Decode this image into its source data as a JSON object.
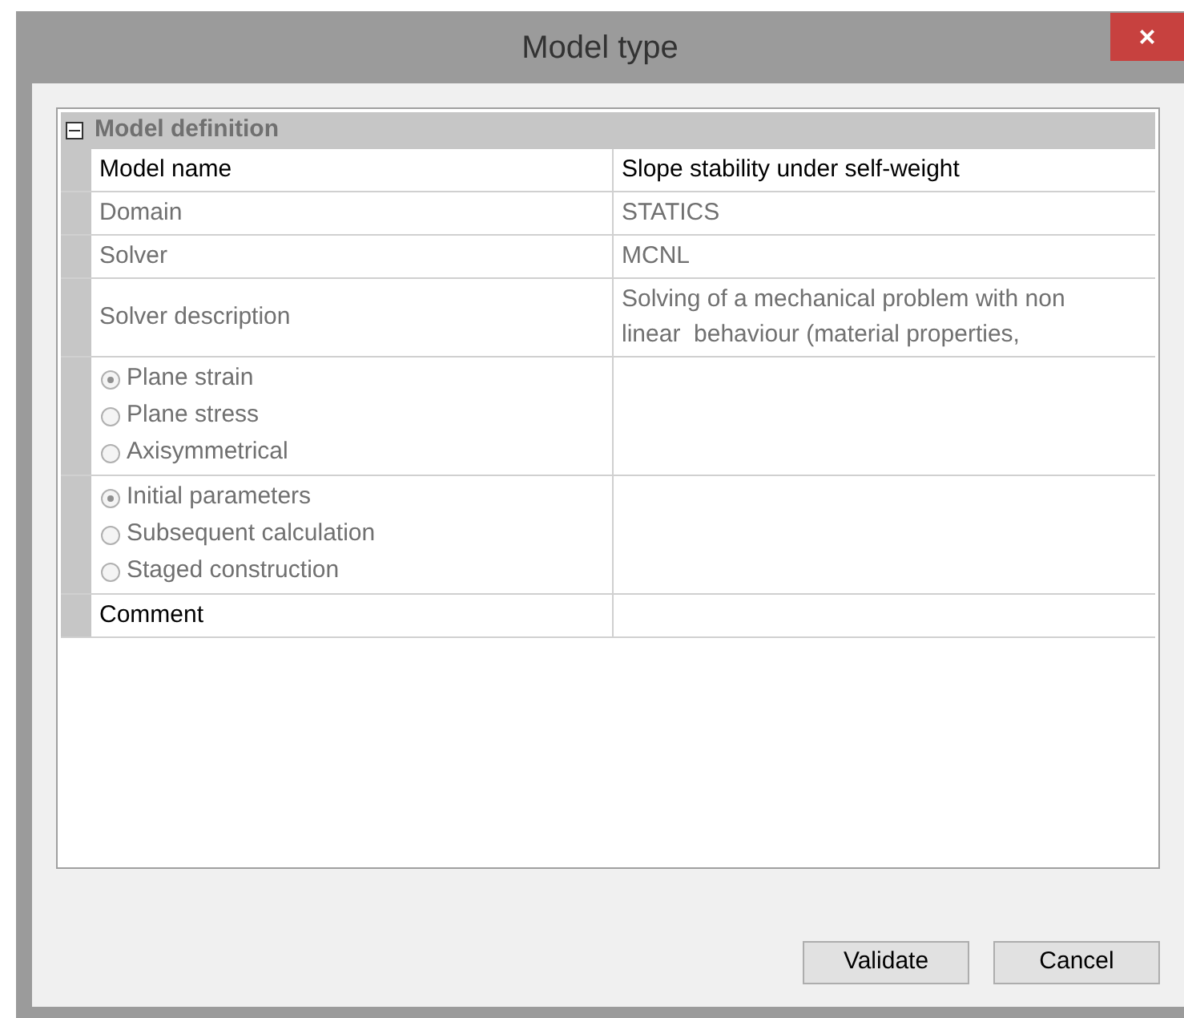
{
  "window": {
    "title": "Model type",
    "close": "×"
  },
  "grid": {
    "category": {
      "label": "Model definition",
      "expanded": true
    },
    "rows": [
      {
        "kind": "text",
        "label": "Model name",
        "value": "Slope stability under self-weight",
        "disabled": false
      },
      {
        "kind": "text",
        "label": "Domain",
        "value": "STATICS",
        "disabled": true
      },
      {
        "kind": "text",
        "label": "Solver",
        "value": "MCNL",
        "disabled": true
      },
      {
        "kind": "text",
        "label": "Solver description",
        "value": "Solving of a mechanical problem with non linear  behaviour (material properties,",
        "disabled": true
      },
      {
        "kind": "radio",
        "options": [
          {
            "label": "Plane strain",
            "selected": true
          },
          {
            "label": "Plane stress",
            "selected": false
          },
          {
            "label": "Axisymmetrical",
            "selected": false
          }
        ]
      },
      {
        "kind": "radio",
        "options": [
          {
            "label": "Initial parameters",
            "selected": true
          },
          {
            "label": "Subsequent calculation",
            "selected": false
          },
          {
            "label": "Staged construction",
            "selected": false
          }
        ]
      },
      {
        "kind": "text",
        "label": "Comment",
        "value": "",
        "disabled": false
      }
    ]
  },
  "buttons": [
    "Validate",
    "Cancel"
  ]
}
